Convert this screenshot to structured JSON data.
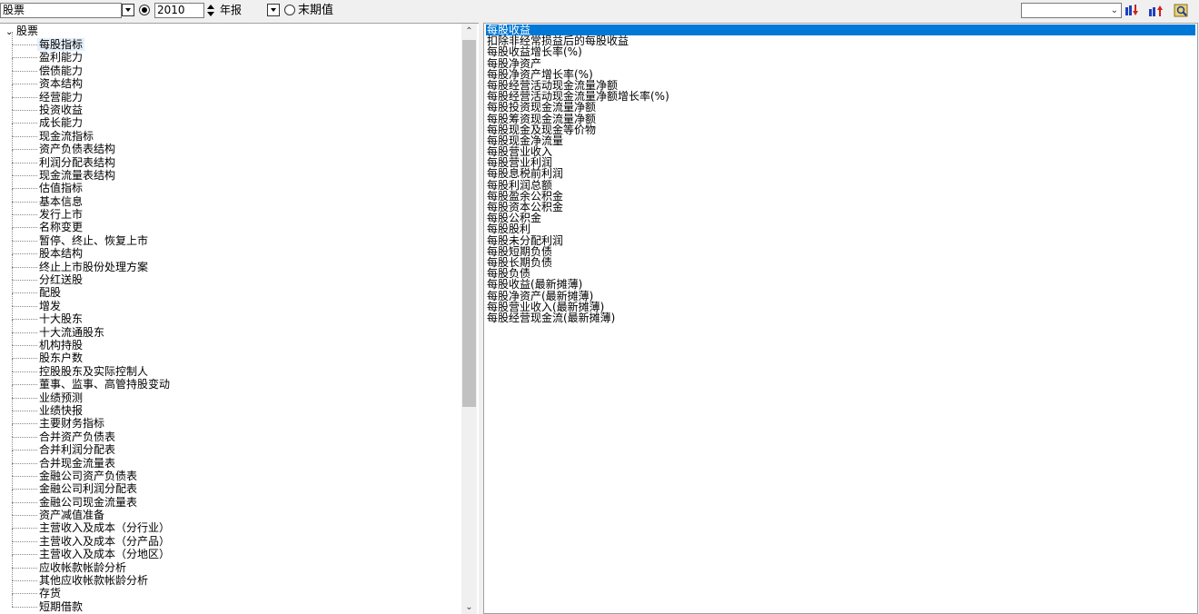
{
  "toolbar": {
    "category_value": "股票",
    "year_value": "2010",
    "period_value": "年报",
    "end_value_label": "末期值",
    "search_value": "",
    "icons": [
      "arrow-down-chart-icon",
      "arrow-up-chart-icon",
      "find-icon"
    ]
  },
  "tree": {
    "root_label": "股票",
    "items": [
      "每股指标",
      "盈利能力",
      "偿债能力",
      "资本结构",
      "经营能力",
      "投资收益",
      "成长能力",
      "现金流指标",
      "资产负债表结构",
      "利润分配表结构",
      "现金流量表结构",
      "估值指标",
      "基本信息",
      "发行上市",
      "名称变更",
      "暂停、终止、恢复上市",
      "股本结构",
      "终止上市股份处理方案",
      "分红送股",
      "配股",
      "增发",
      "十大股东",
      "十大流通股东",
      "机构持股",
      "股东户数",
      "控股股东及实际控制人",
      "董事、监事、高管持股变动",
      "业绩预测",
      "业绩快报",
      "主要财务指标",
      "合并资产负债表",
      "合并利润分配表",
      "合并现金流量表",
      "金融公司资产负债表",
      "金融公司利润分配表",
      "金融公司现金流量表",
      "资产减值准备",
      "主营收入及成本（分行业）",
      "主营收入及成本（分产品）",
      "主营收入及成本（分地区）",
      "应收帐款帐龄分析",
      "其他应收帐款帐龄分析",
      "存货",
      "短期借款"
    ]
  },
  "fields": {
    "items": [
      "每股收益",
      "扣除非经常损益后的每股收益",
      "每股收益增长率(%)",
      "每股净资产",
      "每股净资产增长率(%)",
      "每股经营活动现金流量净额",
      "每股经营活动现金流量净额增长率(%)",
      "每股投资现金流量净额",
      "每股筹资现金流量净额",
      "每股现金及现金等价物",
      "每股现金净流量",
      "每股营业收入",
      "每股营业利润",
      "每股息税前利润",
      "每股利润总额",
      "每股盈余公积金",
      "每股资本公积金",
      "每股公积金",
      "每股股利",
      "每股未分配利润",
      "每股短期负债",
      "每股长期负债",
      "每股负债",
      "每股收益(最新摊薄)",
      "每股净资产(最新摊薄)",
      "每股营业收入(最新摊薄)",
      "每股经营现金流(最新摊薄)"
    ]
  }
}
